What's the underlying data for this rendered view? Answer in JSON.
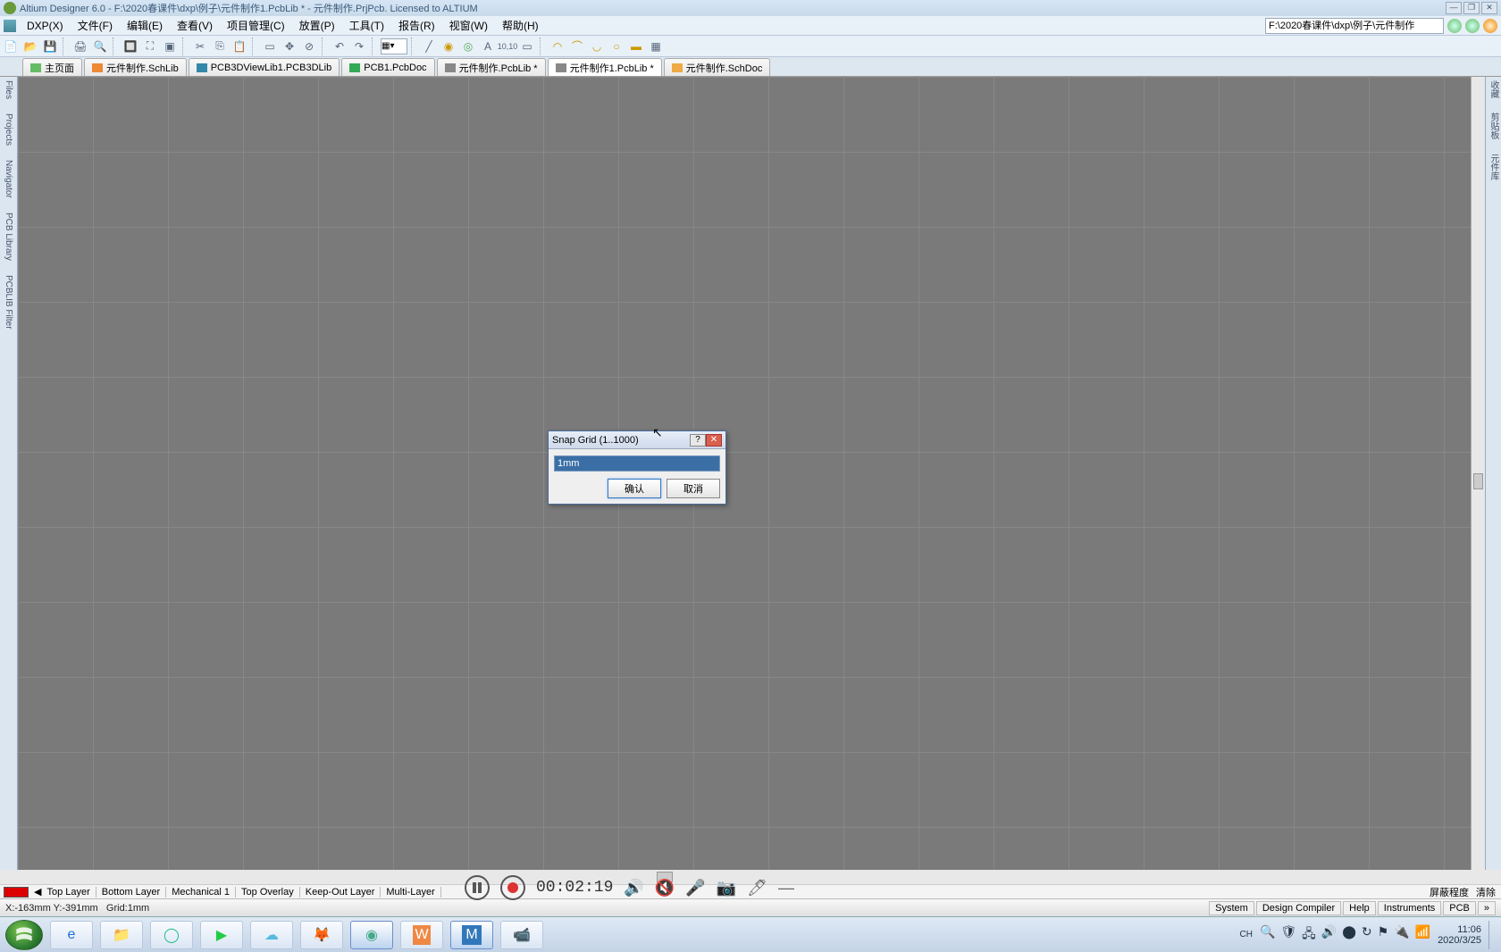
{
  "titlebar": {
    "text": "Altium Designer 6.0 - F:\\2020春课件\\dxp\\例子\\元件制作1.PcbLib * - 元件制作.PrjPcb. Licensed to ALTIUM"
  },
  "menus": {
    "dxp": "DXP(X)",
    "file": "文件(F)",
    "edit": "编辑(E)",
    "view": "查看(V)",
    "project": "项目管理(C)",
    "place": "放置(P)",
    "tools": "工具(T)",
    "report": "报告(R)",
    "window": "视窗(W)",
    "help": "帮助(H)"
  },
  "file_dropdown": "F:\\2020春课件\\dxp\\例子\\元件制作",
  "doctabs": [
    {
      "label": "主页面"
    },
    {
      "label": "元件制作.SchLib"
    },
    {
      "label": "PCB3DViewLib1.PCB3DLib"
    },
    {
      "label": "PCB1.PcbDoc"
    },
    {
      "label": "元件制作.PcbLib *"
    },
    {
      "label": "元件制作1.PcbLib *"
    },
    {
      "label": "元件制作.SchDoc"
    }
  ],
  "left_panels": [
    "Files",
    "Projects",
    "Navigator",
    "PCB Library",
    "PCBLIB Filter"
  ],
  "right_panels": [
    "收藏",
    "剪贴板",
    "元件库"
  ],
  "layertabs": {
    "layers": [
      "Top Layer",
      "Bottom Layer",
      "Mechanical 1",
      "Top Overlay",
      "Keep-Out Layer",
      "Multi-Layer"
    ],
    "right": {
      "mask": "屏蔽程度",
      "clear": "清除"
    }
  },
  "status": {
    "coords": "X:-163mm Y:-391mm",
    "grid": "Grid:1mm",
    "buttons": [
      "System",
      "Design Compiler",
      "Help",
      "Instruments",
      "PCB"
    ]
  },
  "dialog": {
    "title": "Snap Grid (1..1000)",
    "value": "1mm",
    "ok": "确认",
    "cancel": "取消"
  },
  "recorder": {
    "time": "00:02:19"
  },
  "tray": {
    "ime": "CH",
    "time": "11:06",
    "date": "2020/3/25"
  }
}
